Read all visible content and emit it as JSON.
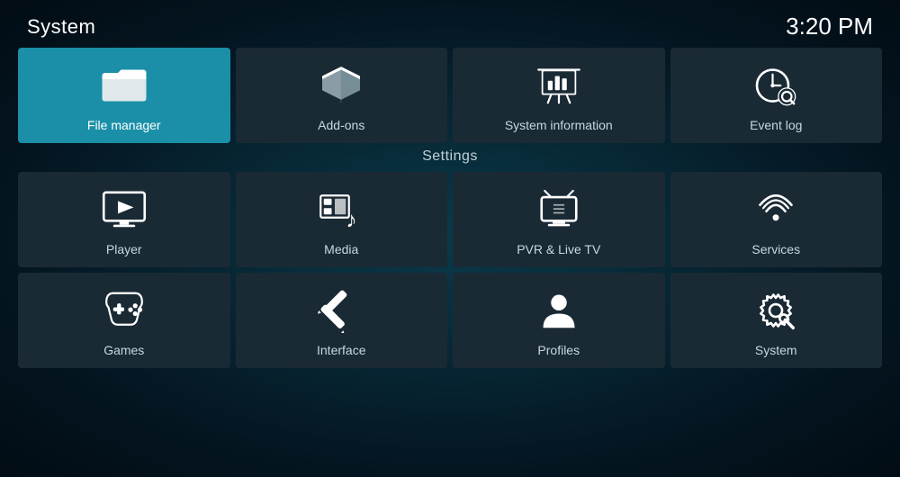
{
  "header": {
    "title": "System",
    "time": "3:20 PM"
  },
  "top_tiles": [
    {
      "id": "file-manager",
      "label": "File manager",
      "active": true
    },
    {
      "id": "add-ons",
      "label": "Add-ons",
      "active": false
    },
    {
      "id": "system-information",
      "label": "System information",
      "active": false
    },
    {
      "id": "event-log",
      "label": "Event log",
      "active": false
    }
  ],
  "settings_heading": "Settings",
  "settings_row1": [
    {
      "id": "player",
      "label": "Player"
    },
    {
      "id": "media",
      "label": "Media"
    },
    {
      "id": "pvr-live-tv",
      "label": "PVR & Live TV"
    },
    {
      "id": "services",
      "label": "Services"
    }
  ],
  "settings_row2": [
    {
      "id": "games",
      "label": "Games"
    },
    {
      "id": "interface",
      "label": "Interface"
    },
    {
      "id": "profiles",
      "label": "Profiles"
    },
    {
      "id": "system",
      "label": "System"
    }
  ]
}
